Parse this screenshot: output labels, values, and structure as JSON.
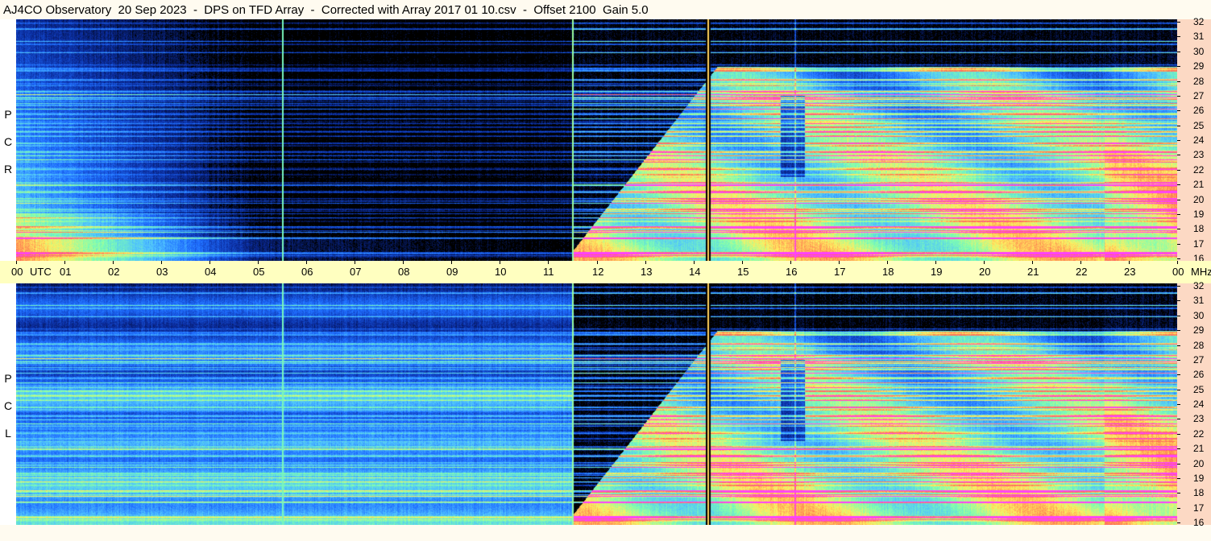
{
  "title": "AJ4CO Observatory  20 Sep 2023  -  DPS on TFD Array  -  Corrected with Array 2017 01 10.csv  -  Offset 2100  Gain 5.0",
  "chart_data": {
    "type": "heatmap",
    "title": "AJ4CO Observatory  20 Sep 2023  -  DPS on TFD Array  -  Corrected with Array 2017 01 10.csv  -  Offset 2100  Gain 5.0",
    "xlabel": "UTC",
    "ylabel": "MHz",
    "x_ticks": [
      "00",
      "01",
      "02",
      "03",
      "04",
      "05",
      "06",
      "07",
      "08",
      "09",
      "10",
      "11",
      "12",
      "13",
      "14",
      "15",
      "16",
      "17",
      "18",
      "19",
      "20",
      "21",
      "22",
      "23",
      "00"
    ],
    "xlim": [
      0,
      24
    ],
    "y_ticks": [
      "32",
      "31",
      "30",
      "29",
      "28",
      "27",
      "26",
      "25",
      "24",
      "23",
      "22",
      "21",
      "20",
      "19",
      "18",
      "17",
      "16"
    ],
    "ylim": [
      16,
      32
    ],
    "panels": [
      {
        "name": "R C P",
        "letters": [
          "R",
          "C",
          "P"
        ]
      },
      {
        "name": "L C P",
        "letters": [
          "L",
          "C",
          "P"
        ]
      }
    ],
    "colormap": [
      "#000000",
      "#0a2a9a",
      "#1e6cff",
      "#4fc3ff",
      "#7fffb0",
      "#fff060",
      "#ff7050",
      "#ff40ff"
    ]
  }
}
